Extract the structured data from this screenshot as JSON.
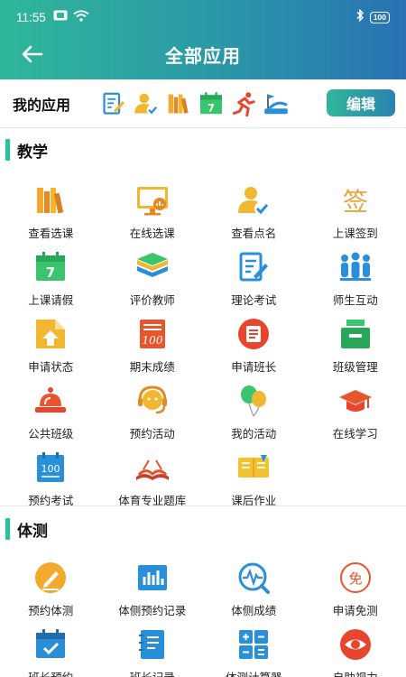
{
  "status": {
    "time": "11:55",
    "battery": "100"
  },
  "header": {
    "title": "全部应用"
  },
  "my_apps": {
    "label": "我的应用",
    "icons": [
      "edit-doc-icon",
      "user-check-icon",
      "books-icon",
      "calendar-7-icon",
      "runner-icon",
      "sprint-flag-icon"
    ],
    "edit_label": "编辑"
  },
  "sections": [
    {
      "title": "教学",
      "items": [
        {
          "label": "查看选课",
          "icon": "books-icon"
        },
        {
          "label": "在线选课",
          "icon": "monitor-chart-icon"
        },
        {
          "label": "查看点名",
          "icon": "user-check-icon"
        },
        {
          "label": "上课签到",
          "icon": "sign-character-icon"
        },
        {
          "label": "上课请假",
          "icon": "calendar-7-icon"
        },
        {
          "label": "评价教师",
          "icon": "layers-icon"
        },
        {
          "label": "理论考试",
          "icon": "edit-doc-icon"
        },
        {
          "label": "师生互动",
          "icon": "people-group-icon"
        },
        {
          "label": "申请状态",
          "icon": "folder-upload-icon"
        },
        {
          "label": "期末成绩",
          "icon": "score-100-icon"
        },
        {
          "label": "申请班长",
          "icon": "message-circle-icon"
        },
        {
          "label": "班级管理",
          "icon": "tray-icon"
        },
        {
          "label": "公共班级",
          "icon": "alarm-bell-icon"
        },
        {
          "label": "预约活动",
          "icon": "headset-support-icon"
        },
        {
          "label": "我的活动",
          "icon": "balloons-icon"
        },
        {
          "label": "在线学习",
          "icon": "grad-cap-icon"
        },
        {
          "label": "预约考试",
          "icon": "calendar-100-icon"
        },
        {
          "label": "体育专业题库",
          "icon": "open-book-icon"
        },
        {
          "label": "课后作业",
          "icon": "notebook-icon"
        }
      ]
    },
    {
      "title": "体测",
      "items": [
        {
          "label": "预约体测",
          "icon": "pen-circle-icon"
        },
        {
          "label": "体侧预约记录",
          "icon": "bar-chart-icon"
        },
        {
          "label": "体侧成绩",
          "icon": "pulse-search-icon"
        },
        {
          "label": "申请免测",
          "icon": "exempt-badge-icon"
        },
        {
          "label": "班长预约",
          "icon": "calendar-check-icon"
        },
        {
          "label": "班长记录",
          "icon": "notepad-icon"
        },
        {
          "label": "体测计算器",
          "icon": "calculator-icon"
        },
        {
          "label": "自助视力",
          "icon": "eye-icon"
        }
      ]
    }
  ],
  "colors": {
    "accent": "#2fb79a",
    "header_end": "#2a72b4",
    "section_bar": "#27c39b"
  }
}
